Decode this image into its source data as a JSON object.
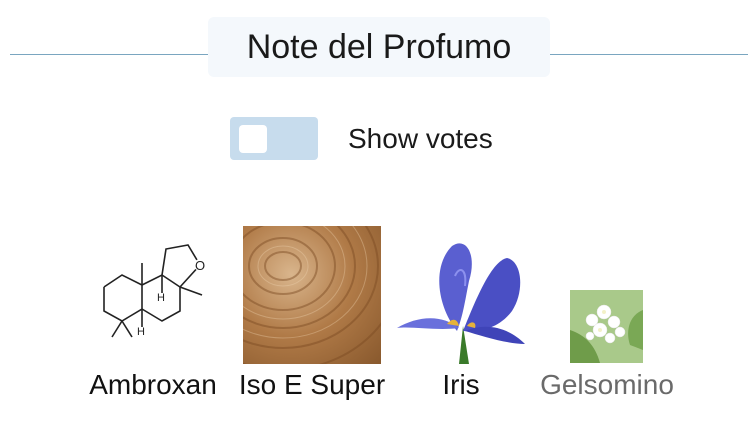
{
  "section": {
    "title": "Note del Profumo"
  },
  "toggle": {
    "label": "Show votes",
    "checked": false
  },
  "notes": [
    {
      "name": "Ambroxan",
      "icon": "ambroxan-molecule-icon"
    },
    {
      "name": "Iso E Super",
      "icon": "wood-grain-image"
    },
    {
      "name": "Iris",
      "icon": "iris-flower-image"
    },
    {
      "name": "Gelsomino",
      "icon": "jasmine-flower-image"
    }
  ],
  "colors": {
    "rule": "#7aa6c0",
    "title_bg": "#f4f8fc",
    "toggle_track": "#c7dced",
    "dim_label": "#6a6a6a"
  }
}
